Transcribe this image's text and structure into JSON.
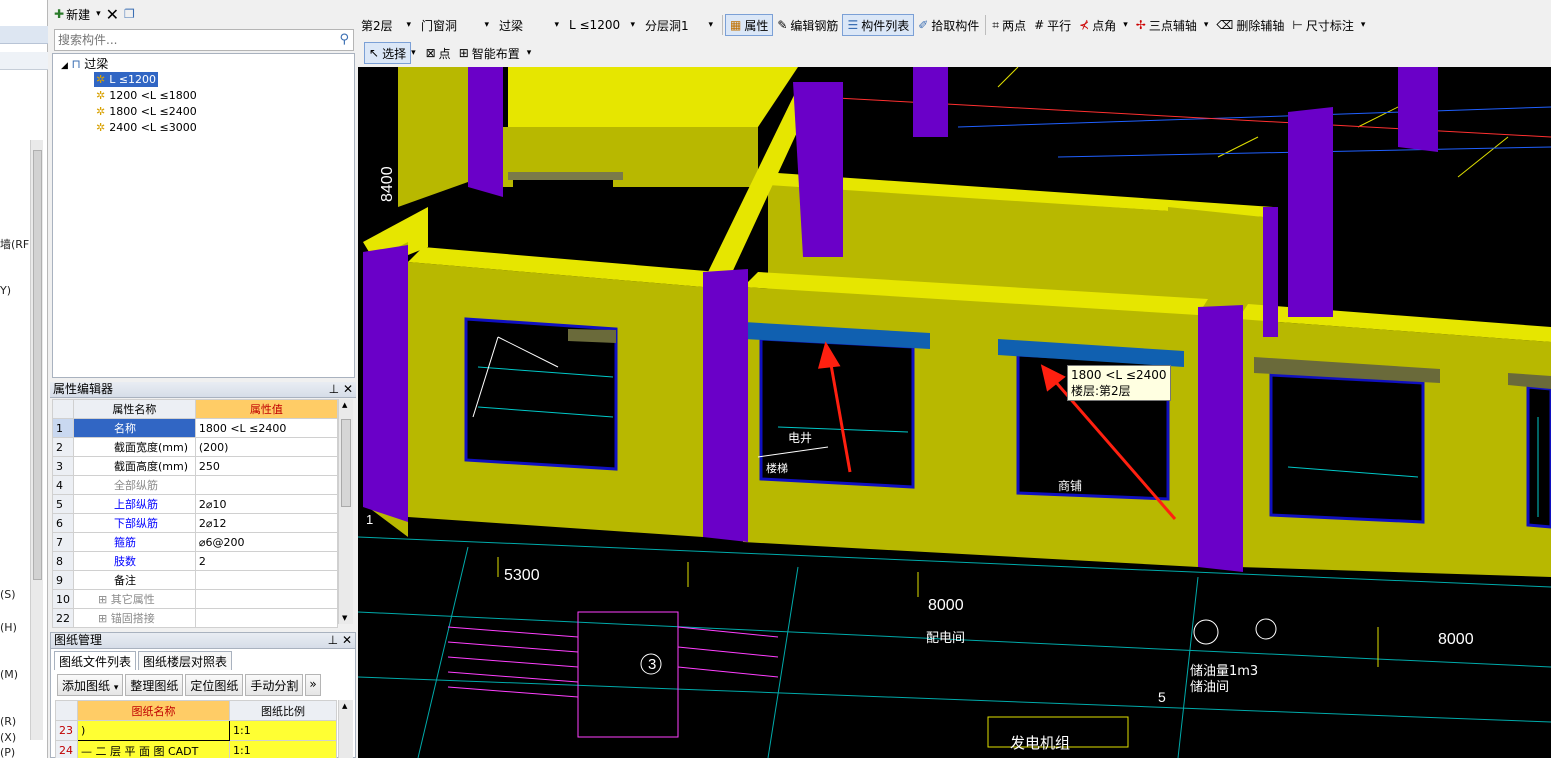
{
  "left_strip": {
    "labels": [
      "墙(RF",
      "Y)",
      "(S)",
      "(H)",
      "(M)",
      "(R)",
      "(X)",
      "(P)"
    ]
  },
  "tree_toolbar": {
    "new_label": "新建",
    "delete_icon": "close-icon",
    "copy_icon": "copy-icon"
  },
  "tree_search": {
    "placeholder": "搜索构件..."
  },
  "tree": {
    "root_label": "过梁",
    "items": [
      "L ≤1200",
      "1200 <L ≤1800",
      "1800 <L ≤2400",
      "2400 <L ≤3000"
    ],
    "selected_index": 0
  },
  "property_editor": {
    "title": "属性编辑器",
    "header_name": "属性名称",
    "header_value": "属性值",
    "rows": [
      {
        "num": "1",
        "name": "名称",
        "value": "1800 <L ≤2400",
        "style": "sel"
      },
      {
        "num": "2",
        "name": "截面宽度(mm)",
        "value": "(200)",
        "style": ""
      },
      {
        "num": "3",
        "name": "截面高度(mm)",
        "value": "250",
        "style": ""
      },
      {
        "num": "4",
        "name": "全部纵筋",
        "value": "",
        "style": "gray"
      },
      {
        "num": "5",
        "name": "上部纵筋",
        "value": "2⌀10",
        "style": "blue"
      },
      {
        "num": "6",
        "name": "下部纵筋",
        "value": "2⌀12",
        "style": "blue"
      },
      {
        "num": "7",
        "name": "箍筋",
        "value": "⌀6@200",
        "style": "blue"
      },
      {
        "num": "8",
        "name": "肢数",
        "value": "2",
        "style": "blue"
      },
      {
        "num": "9",
        "name": "备注",
        "value": "",
        "style": ""
      },
      {
        "num": "10",
        "name": "其它属性",
        "value": "",
        "style": "gray"
      },
      {
        "num": "22",
        "name": "锚固搭接",
        "value": "",
        "style": "gray"
      }
    ]
  },
  "drawing_manager": {
    "title": "图纸管理",
    "tabs": [
      "图纸文件列表",
      "图纸楼层对照表"
    ],
    "tools": [
      "添加图纸",
      "整理图纸",
      "定位图纸",
      "手动分割"
    ],
    "header_name": "图纸名称",
    "header_scale": "图纸比例",
    "rows": [
      {
        "num": "23",
        "name": ")",
        "scale": "1:1"
      },
      {
        "num": "24",
        "name": "— 二 层 平 面 图 CADT",
        "scale": "1:1"
      }
    ]
  },
  "toolbar1": {
    "floor": "第2层",
    "category": "门窗洞",
    "type": "过梁",
    "component": "L ≤1200",
    "layer": "分层洞1",
    "buttons": [
      "属性",
      "编辑钢筋",
      "构件列表",
      "拾取构件",
      "两点",
      "平行",
      "点角",
      "三点辅轴",
      "删除辅轴",
      "尺寸标注"
    ]
  },
  "toolbar2": {
    "select": "选择",
    "point": "点",
    "smart_layout": "智能布置"
  },
  "viewport": {
    "dims": [
      "8400",
      "5300",
      "8000",
      "8000"
    ],
    "axis_numbers": [
      "1",
      "3",
      "5"
    ],
    "room_labels": [
      "电井",
      "楼梯",
      "商铺",
      "配电间",
      "储油量1m3",
      "储油间",
      "发电机组"
    ],
    "tooltip_line1": "1800 <L ≤2400",
    "tooltip_line2": "楼层:第2层",
    "colors": {
      "wall": "#b8b800",
      "wall_top": "#e6e600",
      "column": "#6a00c8",
      "lintel": "#1060b0",
      "background": "#000000"
    }
  }
}
